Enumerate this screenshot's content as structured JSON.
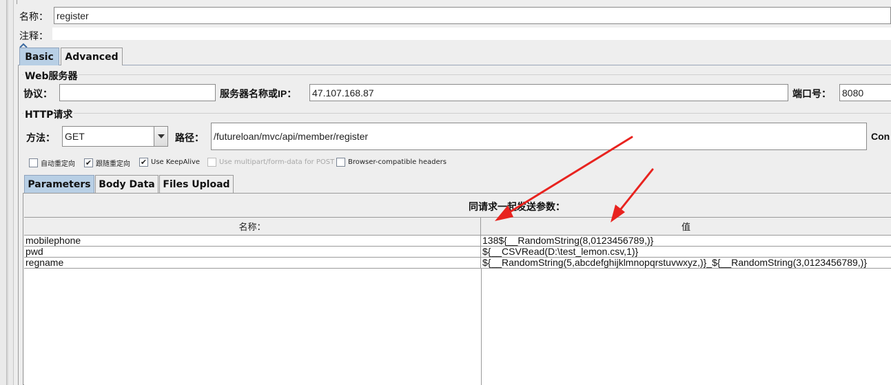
{
  "sampler": {
    "name_label": "名称：",
    "name_value": "register",
    "comment_label": "注释：",
    "comment_value": ""
  },
  "tabs": [
    {
      "label": "Basic",
      "selected": true
    },
    {
      "label": "Advanced",
      "selected": false
    }
  ],
  "web_server": {
    "group_title": "Web服务器",
    "protocol_label": "协议：",
    "protocol_value": "",
    "server_label": "服务器名称或IP：",
    "server_value": "47.107.168.87",
    "port_label": "端口号：",
    "port_value": "8080"
  },
  "http_request": {
    "group_title": "HTTP请求",
    "method_label": "方法：",
    "method_value": "GET",
    "path_label": "路径：",
    "path_value": "/futureloan/mvc/api/member/register",
    "content_encoding_label": "Con"
  },
  "options": [
    {
      "label": "自动重定向",
      "checked": false,
      "enabled": true
    },
    {
      "label": "跟随重定向",
      "checked": true,
      "enabled": true
    },
    {
      "label": "Use KeepAlive",
      "checked": true,
      "enabled": true
    },
    {
      "label": "Use multipart/form-data for POST",
      "checked": false,
      "enabled": false
    },
    {
      "label": "Browser-compatible headers",
      "checked": false,
      "enabled": true
    }
  ],
  "sub_tabs": [
    {
      "label": "Parameters",
      "selected": true
    },
    {
      "label": "Body Data",
      "selected": false
    },
    {
      "label": "Files Upload",
      "selected": false
    }
  ],
  "parameters": {
    "title": "同请求一起发送参数：",
    "columns": [
      "名称：",
      "值"
    ],
    "rows": [
      {
        "name": "mobilephone",
        "value": "138${__RandomString(8,0123456789,)}"
      },
      {
        "name": "pwd",
        "value": "${__CSVRead(D:\\test_lemon.csv,1)}"
      },
      {
        "name": "regname",
        "value": "${__RandomString(5,abcdefghijklmnopqrstuvwxyz,)}_${__RandomString(3,0123456789,)}"
      }
    ]
  },
  "colors": {
    "selected_tab": "#b8cfe5",
    "annotation_arrow": "#e8231f"
  },
  "icons": {
    "combo_arrow": "chevron-down-icon",
    "check": "check-icon"
  }
}
